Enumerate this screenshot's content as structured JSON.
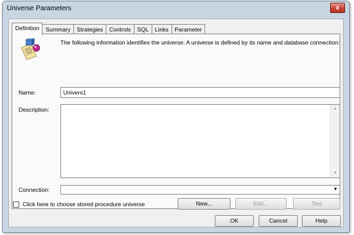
{
  "window": {
    "title": "Universe Parameters",
    "close_glyph": "x"
  },
  "tabs": [
    {
      "label": "Definition",
      "active": true
    },
    {
      "label": "Summary"
    },
    {
      "label": "Strategies"
    },
    {
      "label": "Controls"
    },
    {
      "label": "SQL"
    },
    {
      "label": "Links"
    },
    {
      "label": "Parameter"
    }
  ],
  "definition": {
    "info_text": "The following information identifies the universe. A universe is defined by its name and database connection:",
    "icon": "universe-icon",
    "name_label": "Name:",
    "name_value": "Univers1",
    "description_label": "Description:",
    "description_value": "",
    "connection_label": "Connection:",
    "connection_value": "",
    "buttons": {
      "new": "New...",
      "edit": "Edit...",
      "test": "Test"
    },
    "stored_procedure_label": "Click here to choose stored procedure universe",
    "stored_procedure_checked": false
  },
  "footer": {
    "ok": "OK",
    "cancel": "Cancel",
    "help": "Help"
  },
  "colors": {
    "close_button": "#c8433a",
    "frame": "#c8d6e4",
    "panel": "#fafafa"
  }
}
